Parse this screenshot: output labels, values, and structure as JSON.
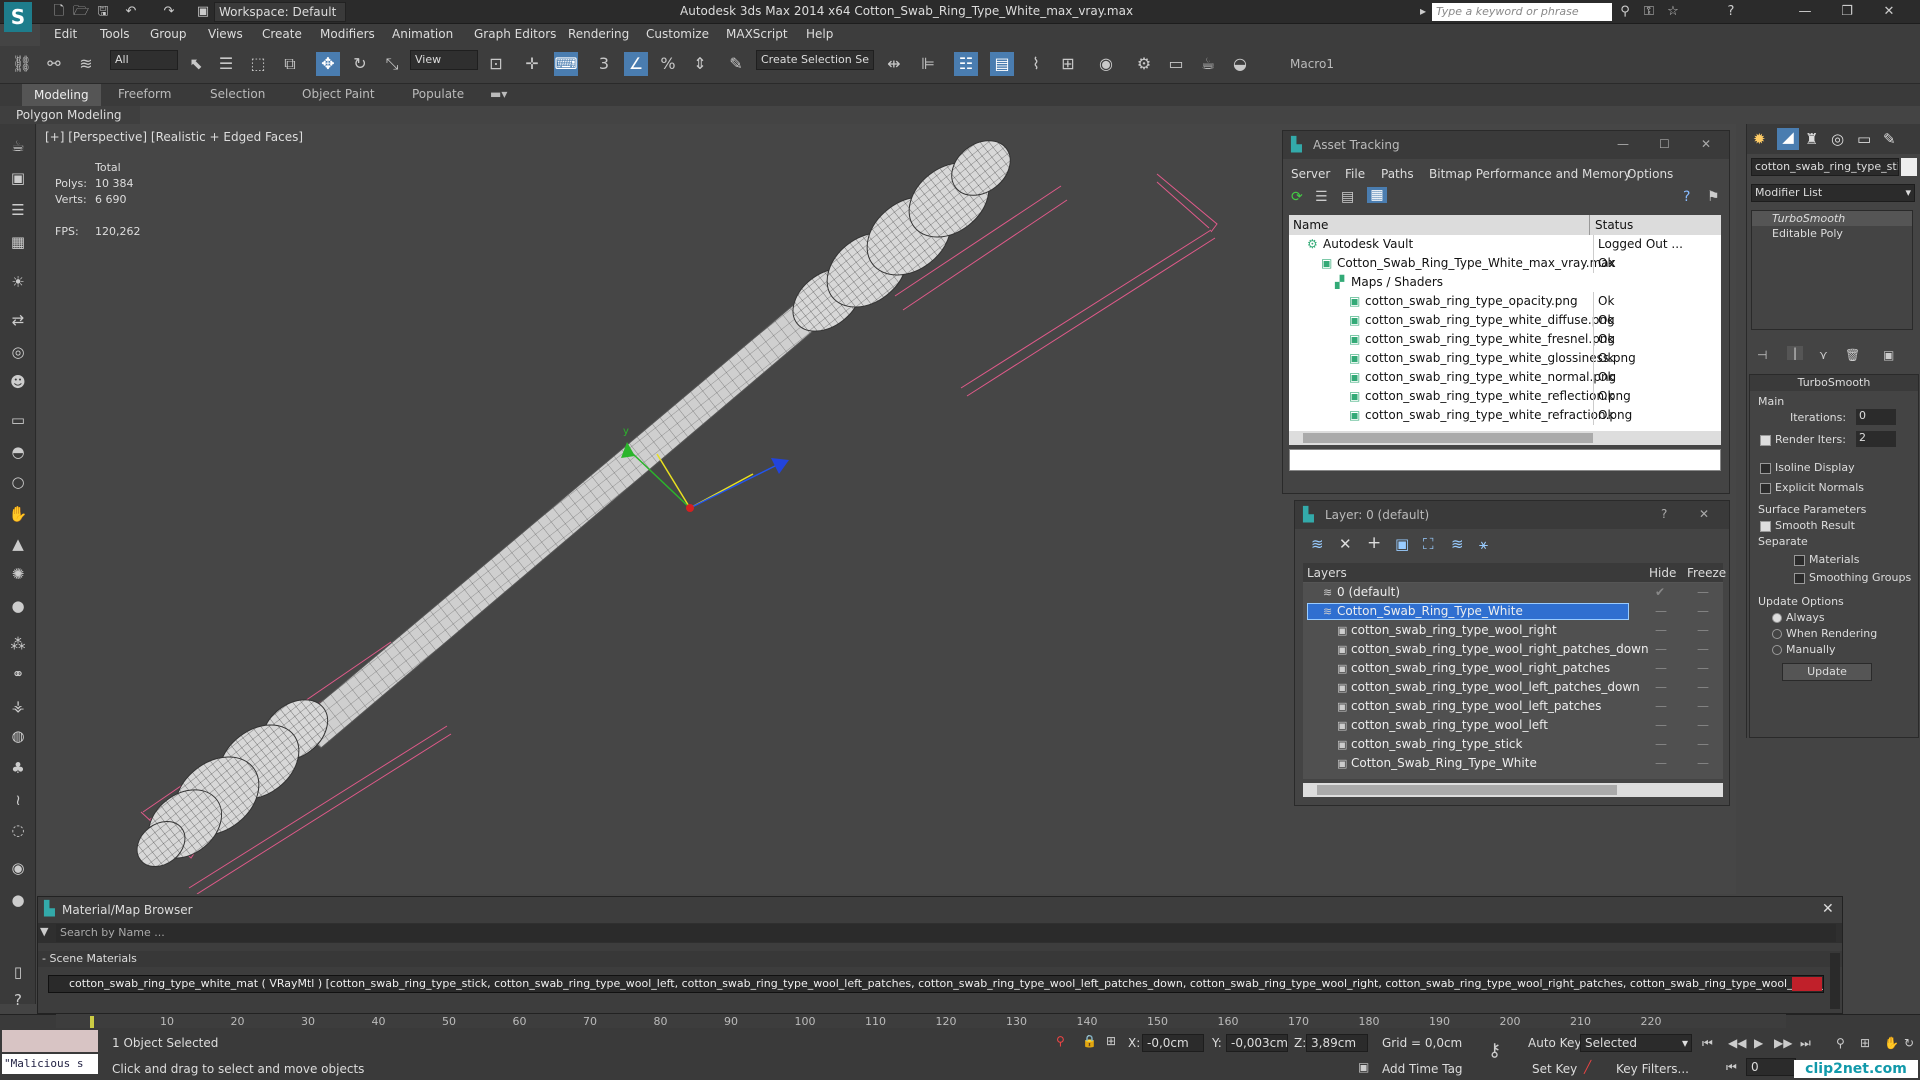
{
  "window": {
    "title": "Autodesk 3ds Max  2014 x64     Cotton_Swab_Ring_Type_White_max_vray.max",
    "workspace": "Workspace: Default",
    "search_placeholder": "Type a keyword or phrase"
  },
  "menu": [
    "Edit",
    "Tools",
    "Group",
    "Views",
    "Create",
    "Modifiers",
    "Animation",
    "Graph Editors",
    "Rendering",
    "Customize",
    "MAXScript",
    "Help"
  ],
  "toolbar": {
    "selection_filter": "All",
    "ref_coord": "View",
    "named_selection": "Create Selection Se",
    "macro": "Macro1"
  },
  "ribbon": {
    "tabs": [
      "Modeling",
      "Freeform",
      "Selection",
      "Object Paint",
      "Populate"
    ],
    "sub": "Polygon Modeling"
  },
  "viewport": {
    "label": "[+] [Perspective] [Realistic + Edged Faces]",
    "stats": {
      "total": "Total",
      "polys_label": "Polys:",
      "polys": "10 384",
      "verts_label": "Verts:",
      "verts": "6 690",
      "fps_label": "FPS:",
      "fps": "120,262"
    }
  },
  "asset_tracking": {
    "title": "Asset Tracking",
    "menu": [
      "Server",
      "File",
      "Paths",
      "Bitmap Performance and Memory",
      "Options"
    ],
    "col_name": "Name",
    "col_status": "Status",
    "rows": [
      {
        "name": "Autodesk Vault",
        "status": "Logged Out ...",
        "indent": 0
      },
      {
        "name": "Cotton_Swab_Ring_Type_White_max_vray.max",
        "status": "Ok",
        "indent": 1
      },
      {
        "name": "Maps / Shaders",
        "status": "",
        "indent": 2
      },
      {
        "name": "cotton_swab_ring_type_opacity.png",
        "status": "Ok",
        "indent": 3
      },
      {
        "name": "cotton_swab_ring_type_white_diffuse.png",
        "status": "Ok",
        "indent": 3
      },
      {
        "name": "cotton_swab_ring_type_white_fresnel.png",
        "status": "Ok",
        "indent": 3
      },
      {
        "name": "cotton_swab_ring_type_white_glossiness.png",
        "status": "Ok",
        "indent": 3
      },
      {
        "name": "cotton_swab_ring_type_white_normal.png",
        "status": "Ok",
        "indent": 3
      },
      {
        "name": "cotton_swab_ring_type_white_reflection.png",
        "status": "Ok",
        "indent": 3
      },
      {
        "name": "cotton_swab_ring_type_white_refraction.png",
        "status": "Ok",
        "indent": 3
      }
    ]
  },
  "layers": {
    "title": "Layer: 0 (default)",
    "col_layers": "Layers",
    "col_hide": "Hide",
    "col_freeze": "Freeze",
    "rows": [
      {
        "name": "0 (default)",
        "indent": 0,
        "selected": false
      },
      {
        "name": "Cotton_Swab_Ring_Type_White",
        "indent": 0,
        "selected": true
      },
      {
        "name": "cotton_swab_ring_type_wool_right",
        "indent": 1,
        "selected": false
      },
      {
        "name": "cotton_swab_ring_type_wool_right_patches_down",
        "indent": 1,
        "selected": false
      },
      {
        "name": "cotton_swab_ring_type_wool_right_patches",
        "indent": 1,
        "selected": false
      },
      {
        "name": "cotton_swab_ring_type_wool_left_patches_down",
        "indent": 1,
        "selected": false
      },
      {
        "name": "cotton_swab_ring_type_wool_left_patches",
        "indent": 1,
        "selected": false
      },
      {
        "name": "cotton_swab_ring_type_wool_left",
        "indent": 1,
        "selected": false
      },
      {
        "name": "cotton_swab_ring_type_stick",
        "indent": 1,
        "selected": false
      },
      {
        "name": "Cotton_Swab_Ring_Type_White",
        "indent": 1,
        "selected": false
      }
    ]
  },
  "command_panel": {
    "object_name": "cotton_swab_ring_type_stick",
    "modifier_list": "Modifier List",
    "stack": [
      "TurboSmooth",
      "Editable Poly"
    ],
    "turbosmooth": {
      "title": "TurboSmooth",
      "main": "Main",
      "iterations_label": "Iterations:",
      "iterations": "0",
      "render_iters_label": "Render Iters:",
      "render_iters": "2",
      "isoline": "Isoline Display",
      "explicit_normals": "Explicit Normals",
      "surface_params": "Surface Parameters",
      "smooth_result": "Smooth Result",
      "separate": "Separate",
      "materials": "Materials",
      "smoothing_groups": "Smoothing Groups",
      "update_options": "Update Options",
      "always": "Always",
      "when_rendering": "When Rendering",
      "manually": "Manually",
      "update": "Update"
    }
  },
  "material_browser": {
    "title": "Material/Map Browser",
    "search_placeholder": "Search by Name ...",
    "section": "- Scene Materials",
    "material": "cotton_swab_ring_type_white_mat ( VRayMtl ) [cotton_swab_ring_type_stick, cotton_swab_ring_type_wool_left, cotton_swab_ring_type_wool_left_patches, cotton_swab_ring_type_wool_left_patches_down, cotton_swab_ring_type_wool_right, cotton_swab_ring_type_wool_right_patches, cotton_swab_ring_type_wool_right_patches_down]"
  },
  "timeline": {
    "ticks": [
      "10",
      "20",
      "30",
      "40",
      "50",
      "60",
      "70",
      "80",
      "90",
      "100",
      "110",
      "120",
      "130",
      "140",
      "150",
      "160",
      "170",
      "180",
      "190",
      "200",
      "210",
      "220"
    ]
  },
  "status": {
    "script": "\"Malicious s",
    "selected": "1 Object Selected",
    "hint": "Click and drag to select and move objects",
    "x_label": "X:",
    "x": "-0,0cm",
    "y_label": "Y:",
    "y": "-0,003cm",
    "z_label": "Z:",
    "z": "3,89cm",
    "grid": "Grid = 0,0cm",
    "add_time_tag": "Add Time Tag",
    "auto_key": "Auto Key",
    "set_key": "Set Key",
    "key_mode": "Selected",
    "key_filters": "Key Filters...",
    "frame": "0",
    "watermark": "clip2net.com"
  }
}
